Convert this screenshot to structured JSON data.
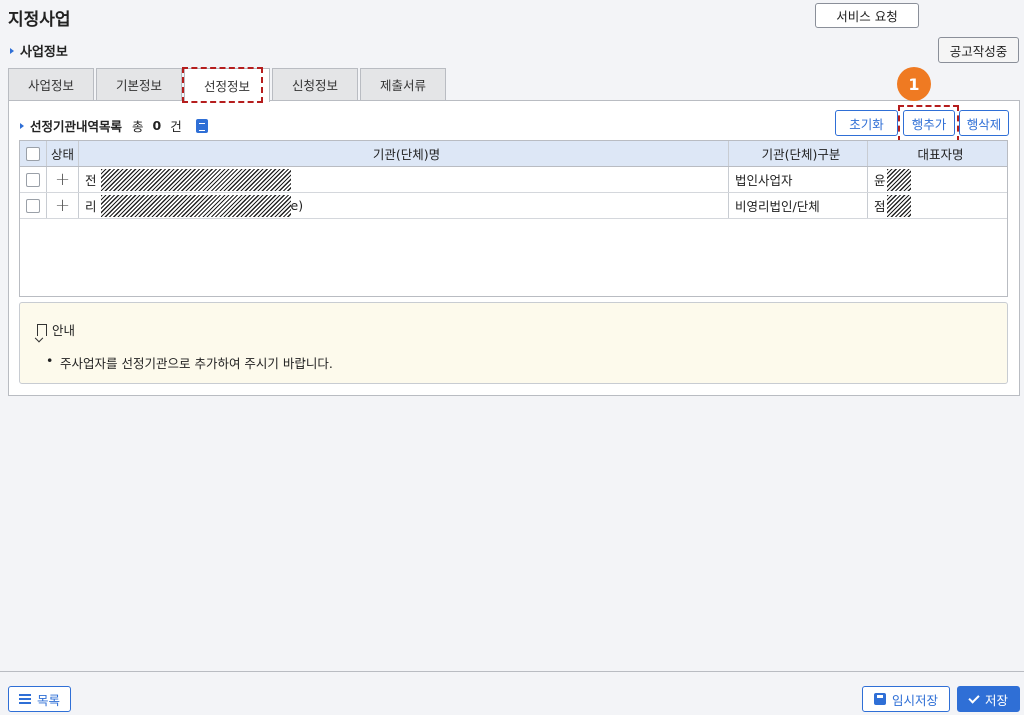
{
  "page": {
    "title": "지정사업",
    "service_request_label": "서비스 요청",
    "section_title": "사업정보",
    "status_badge": "공고작성중"
  },
  "tabs": [
    {
      "label": "사업정보",
      "active": false
    },
    {
      "label": "기본정보",
      "active": false
    },
    {
      "label": "선정정보",
      "active": true
    },
    {
      "label": "신청정보",
      "active": false
    },
    {
      "label": "제출서류",
      "active": false
    }
  ],
  "list": {
    "title": "선정기관내역목록",
    "count_prefix": "총",
    "count": "0",
    "count_suffix": "건",
    "reset_label": "초기화",
    "add_row_label": "행추가",
    "delete_row_label": "행삭제",
    "step_number": "1"
  },
  "grid": {
    "headers": [
      "상태",
      "기관(단체)명",
      "기관(단체)구분",
      "대표자명"
    ],
    "rows": [
      {
        "name_visible": "전",
        "name_suffix": "",
        "type": "법인사업자",
        "rep_visible": "윤"
      },
      {
        "name_visible": "리",
        "name_suffix": "e)",
        "type": "비영리법인/단체",
        "rep_visible": "점"
      }
    ]
  },
  "guide": {
    "title": "안내",
    "items": [
      "주사업자를 선정기관으로 추가하여 주시기 바랍니다."
    ]
  },
  "footer": {
    "list_label": "목록",
    "temp_save_label": "임시저장",
    "save_label": "저장"
  },
  "colors": {
    "accent": "#2f6fd6",
    "highlight": "#b51d1d",
    "step_badge": "#ef7a22",
    "grid_header": "#dde7f6",
    "guide_bg": "#fdfaec"
  },
  "icons": [
    "triangle-bullet-icon",
    "document-icon",
    "plus-icon",
    "bookmark-icon",
    "list-icon",
    "save-icon",
    "check-icon"
  ]
}
